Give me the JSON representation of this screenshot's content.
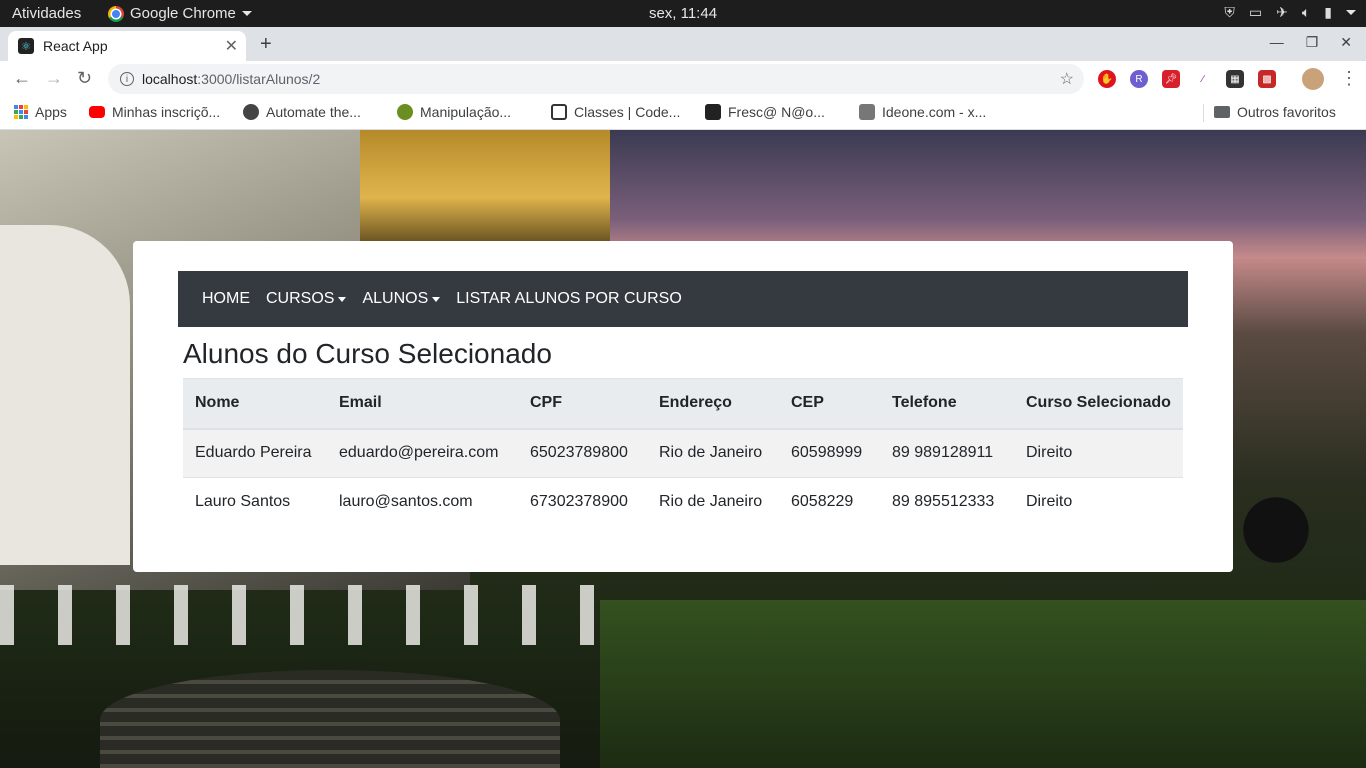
{
  "system": {
    "activities": "Atividades",
    "app_menu": "Google Chrome",
    "clock": "sex, 11:44"
  },
  "browser": {
    "tab_title": "React App",
    "url_host": "localhost",
    "url_path": ":3000/listarAlunos/2",
    "bookmarks": [
      {
        "label": "Apps",
        "icon": "apps-grid-icon"
      },
      {
        "label": "Minhas inscriçõ...",
        "icon": "youtube-icon",
        "color": "#ff0000"
      },
      {
        "label": "Automate the...",
        "icon": "globe-icon",
        "color": "#444444"
      },
      {
        "label": "Manipulação...",
        "icon": "site-icon",
        "color": "#6b8e23"
      },
      {
        "label": "Classes | Code...",
        "icon": "code-icon",
        "color": "#333333"
      },
      {
        "label": "Fresc@ N@o...",
        "icon": "site-icon",
        "color": "#222222"
      },
      {
        "label": "Ideone.com - x...",
        "icon": "ideone-icon",
        "color": "#555555"
      }
    ],
    "other_bookmarks": "Outros favoritos"
  },
  "navbar": {
    "home": "HOME",
    "cursos": "CURSOS",
    "alunos": "ALUNOS",
    "listar": "LISTAR ALUNOS POR CURSO"
  },
  "page": {
    "title": "Alunos do Curso Selecionado"
  },
  "table": {
    "headers": [
      "Nome",
      "Email",
      "CPF",
      "Endereço",
      "CEP",
      "Telefone",
      "Curso Selecionado"
    ],
    "rows": [
      [
        "Eduardo Pereira",
        "eduardo@pereira.com",
        "65023789800",
        "Rio de Janeiro",
        "60598999",
        "89 989128911",
        "Direito"
      ],
      [
        "Lauro Santos",
        "lauro@santos.com",
        "67302378900",
        "Rio de Janeiro",
        "6058229",
        "89 895512333",
        "Direito"
      ]
    ]
  },
  "colors": {
    "navbar_bg": "#343a40",
    "table_header_bg": "#e9ecef"
  }
}
